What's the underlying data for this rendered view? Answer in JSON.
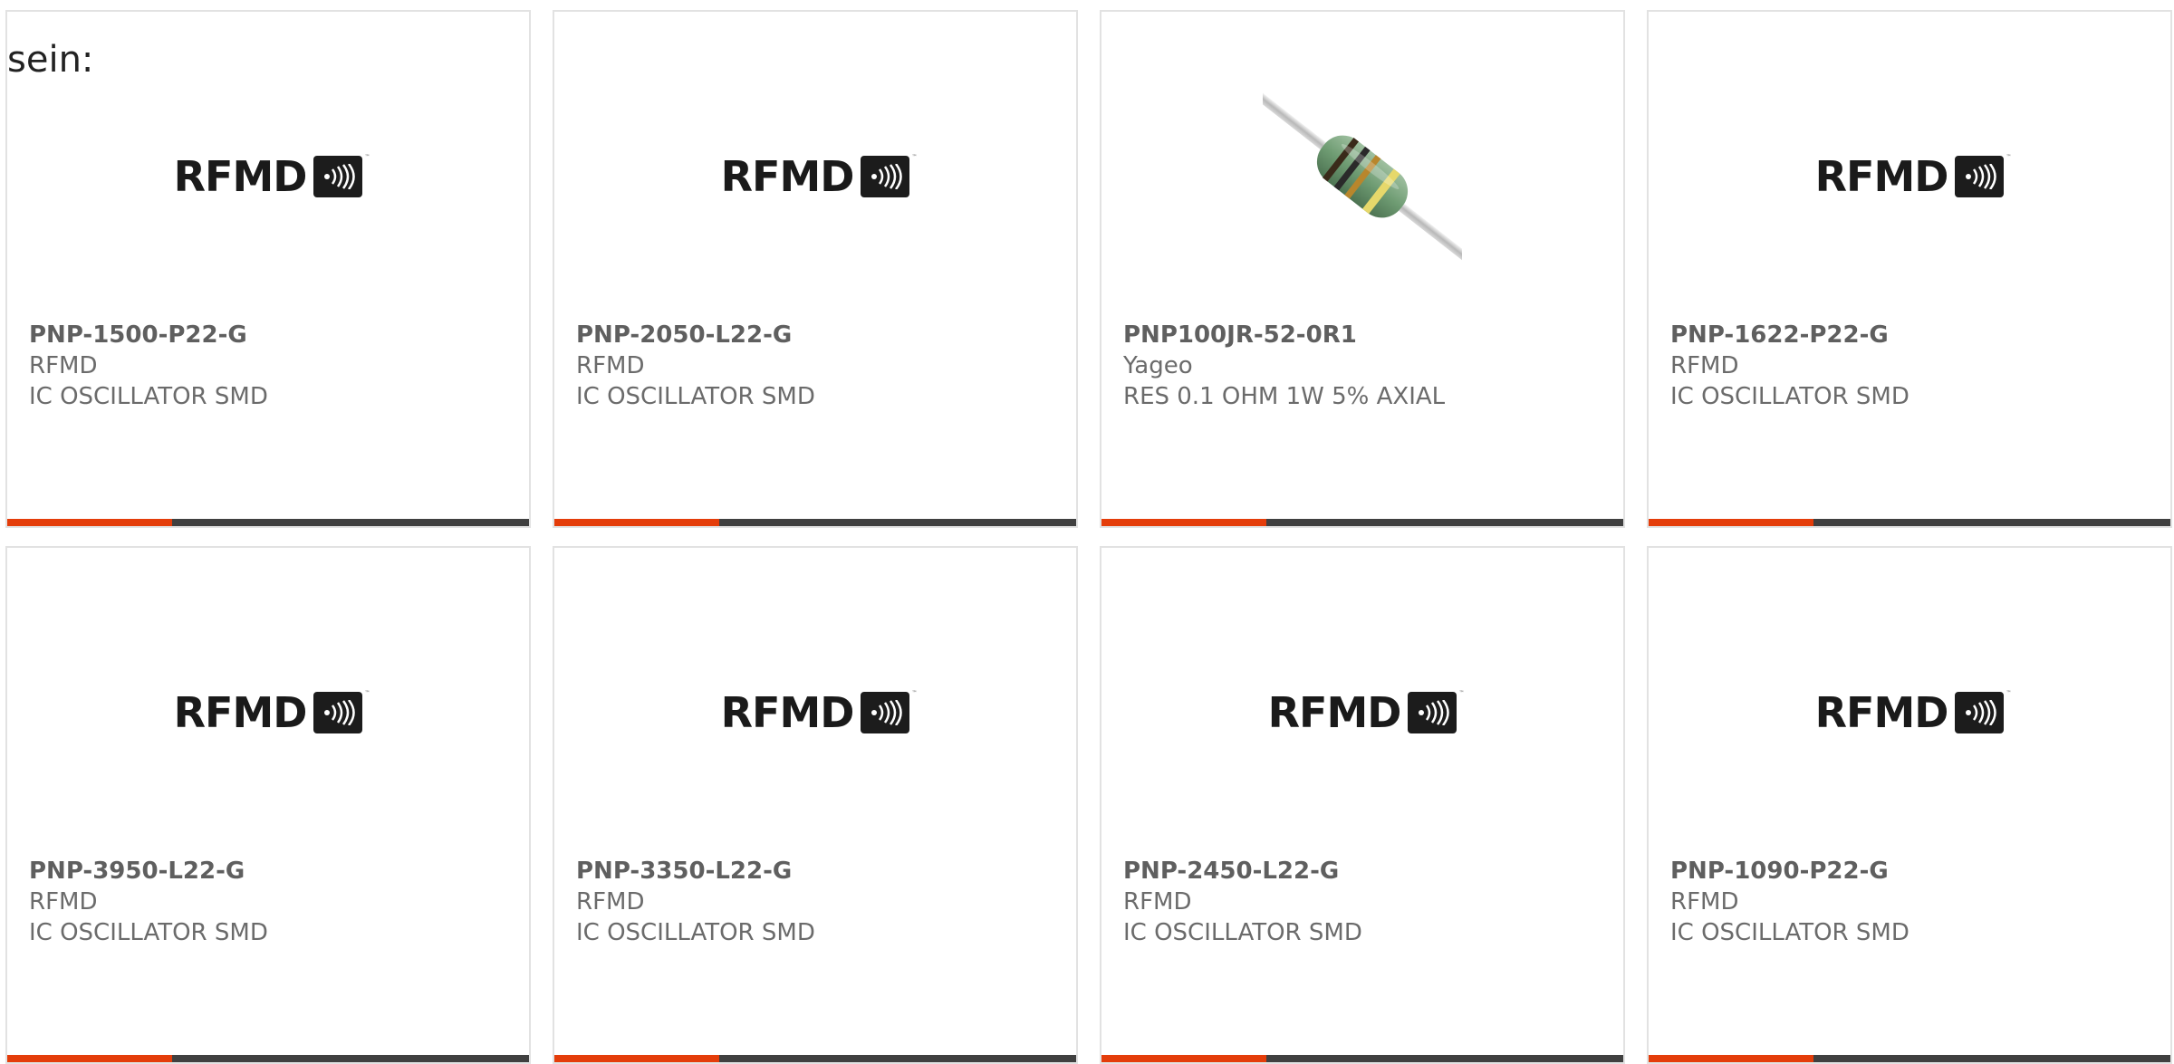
{
  "intro_text": "sein:",
  "colors": {
    "accent": "#e43d0a",
    "bar": "#404040",
    "text": "#6b6b6b",
    "border": "#e2e2e2"
  },
  "products": [
    {
      "part_number": "PNP-1500-P22-G",
      "manufacturer": "RFMD",
      "description": "IC OSCILLATOR SMD",
      "image": "rfmd-logo",
      "logo_text": "RFMD"
    },
    {
      "part_number": "PNP-2050-L22-G",
      "manufacturer": "RFMD",
      "description": "IC OSCILLATOR SMD",
      "image": "rfmd-logo",
      "logo_text": "RFMD"
    },
    {
      "part_number": "PNP100JR-52-0R1",
      "manufacturer": "Yageo",
      "description": "RES 0.1 OHM 1W 5% AXIAL",
      "image": "resistor-photo"
    },
    {
      "part_number": "PNP-1622-P22-G",
      "manufacturer": "RFMD",
      "description": "IC OSCILLATOR SMD",
      "image": "rfmd-logo",
      "logo_text": "RFMD"
    },
    {
      "part_number": "PNP-3950-L22-G",
      "manufacturer": "RFMD",
      "description": "IC OSCILLATOR SMD",
      "image": "rfmd-logo",
      "logo_text": "RFMD"
    },
    {
      "part_number": "PNP-3350-L22-G",
      "manufacturer": "RFMD",
      "description": "IC OSCILLATOR SMD",
      "image": "rfmd-logo",
      "logo_text": "RFMD"
    },
    {
      "part_number": "PNP-2450-L22-G",
      "manufacturer": "RFMD",
      "description": "IC OSCILLATOR SMD",
      "image": "rfmd-logo",
      "logo_text": "RFMD"
    },
    {
      "part_number": "PNP-1090-P22-G",
      "manufacturer": "RFMD",
      "description": "IC OSCILLATOR SMD",
      "image": "rfmd-logo",
      "logo_text": "RFMD"
    }
  ]
}
